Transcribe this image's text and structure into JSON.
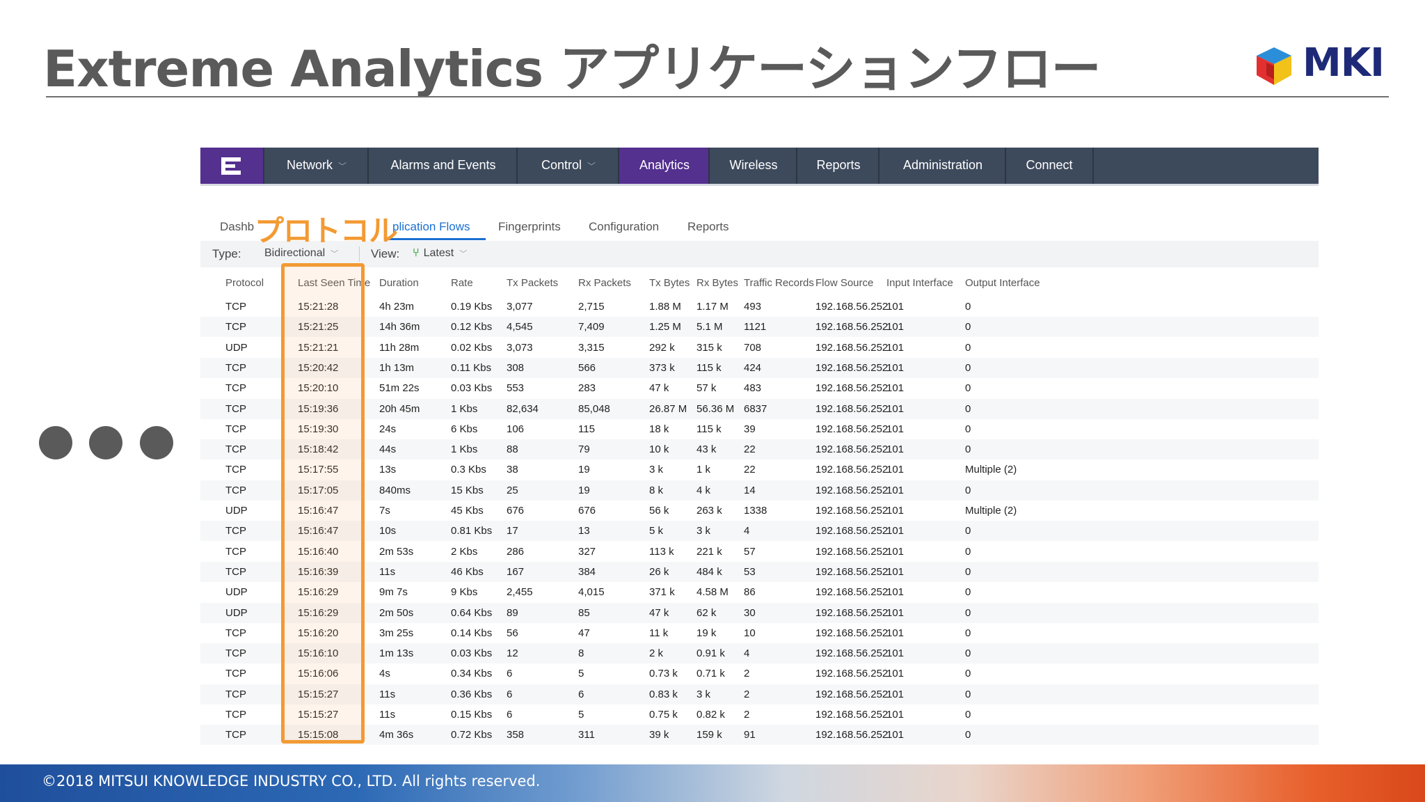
{
  "slide": {
    "title": "Extreme Analytics アプリケーションフロー",
    "logo_text": "MKI",
    "footer": "©2018 MITSUI KNOWLEDGE INDUSTRY CO., LTD. All rights reserved.",
    "annotation": "プロトコル"
  },
  "colors": {
    "nav_bg": "#3d4a5c",
    "nav_active": "#54308f",
    "highlight": "#f39a33",
    "link": "#1a6fd1"
  },
  "nav": {
    "logo_icon": "extreme-e-icon",
    "items": [
      "Network",
      "Alarms and Events",
      "Control",
      "Analytics",
      "Wireless",
      "Reports",
      "Administration",
      "Connect"
    ],
    "active": "Analytics"
  },
  "subtabs": [
    "Dashb",
    "plication Flows",
    "Fingerprints",
    "Configuration",
    "Reports"
  ],
  "filters": {
    "type_label": "Type:",
    "type_value": "Bidirectional",
    "view_label": "View:",
    "view_value": "Latest"
  },
  "table": {
    "columns": [
      "Protocol",
      "Last Seen Time",
      "Duration",
      "Rate",
      "Tx Packets",
      "Rx Packets",
      "Tx Bytes",
      "Rx Bytes",
      "Traffic Records",
      "Flow Source",
      "Input Interface",
      "Output Interface"
    ],
    "rows": [
      [
        "TCP",
        "15:21:28",
        "4h 23m",
        "0.19 Kbs",
        "3,077",
        "2,715",
        "1.88 M",
        "1.17 M",
        "493",
        "192.168.56.252",
        "101",
        "0"
      ],
      [
        "TCP",
        "15:21:25",
        "14h 36m",
        "0.12 Kbs",
        "4,545",
        "7,409",
        "1.25 M",
        "5.1 M",
        "1121",
        "192.168.56.252",
        "101",
        "0"
      ],
      [
        "UDP",
        "15:21:21",
        "11h 28m",
        "0.02 Kbs",
        "3,073",
        "3,315",
        "292 k",
        "315 k",
        "708",
        "192.168.56.252",
        "101",
        "0"
      ],
      [
        "TCP",
        "15:20:42",
        "1h 13m",
        "0.11 Kbs",
        "308",
        "566",
        "373 k",
        "115 k",
        "424",
        "192.168.56.252",
        "101",
        "0"
      ],
      [
        "TCP",
        "15:20:10",
        "51m 22s",
        "0.03 Kbs",
        "553",
        "283",
        "47 k",
        "57 k",
        "483",
        "192.168.56.252",
        "101",
        "0"
      ],
      [
        "TCP",
        "15:19:36",
        "20h 45m",
        "1 Kbs",
        "82,634",
        "85,048",
        "26.87 M",
        "56.36 M",
        "6837",
        "192.168.56.252",
        "101",
        "0"
      ],
      [
        "TCP",
        "15:19:30",
        "24s",
        "6 Kbs",
        "106",
        "115",
        "18 k",
        "115 k",
        "39",
        "192.168.56.252",
        "101",
        "0"
      ],
      [
        "TCP",
        "15:18:42",
        "44s",
        "1 Kbs",
        "88",
        "79",
        "10 k",
        "43 k",
        "22",
        "192.168.56.252",
        "101",
        "0"
      ],
      [
        "TCP",
        "15:17:55",
        "13s",
        "0.3 Kbs",
        "38",
        "19",
        "3 k",
        "1 k",
        "22",
        "192.168.56.252",
        "101",
        "Multiple (2)"
      ],
      [
        "TCP",
        "15:17:05",
        "840ms",
        "15 Kbs",
        "25",
        "19",
        "8 k",
        "4 k",
        "14",
        "192.168.56.252",
        "101",
        "0"
      ],
      [
        "UDP",
        "15:16:47",
        "7s",
        "45 Kbs",
        "676",
        "676",
        "56 k",
        "263 k",
        "1338",
        "192.168.56.252",
        "101",
        "Multiple (2)"
      ],
      [
        "TCP",
        "15:16:47",
        "10s",
        "0.81 Kbs",
        "17",
        "13",
        "5 k",
        "3 k",
        "4",
        "192.168.56.252",
        "101",
        "0"
      ],
      [
        "TCP",
        "15:16:40",
        "2m 53s",
        "2 Kbs",
        "286",
        "327",
        "113 k",
        "221 k",
        "57",
        "192.168.56.252",
        "101",
        "0"
      ],
      [
        "TCP",
        "15:16:39",
        "11s",
        "46 Kbs",
        "167",
        "384",
        "26 k",
        "484 k",
        "53",
        "192.168.56.252",
        "101",
        "0"
      ],
      [
        "UDP",
        "15:16:29",
        "9m 7s",
        "9 Kbs",
        "2,455",
        "4,015",
        "371 k",
        "4.58 M",
        "86",
        "192.168.56.252",
        "101",
        "0"
      ],
      [
        "UDP",
        "15:16:29",
        "2m 50s",
        "0.64 Kbs",
        "89",
        "85",
        "47 k",
        "62 k",
        "30",
        "192.168.56.252",
        "101",
        "0"
      ],
      [
        "TCP",
        "15:16:20",
        "3m 25s",
        "0.14 Kbs",
        "56",
        "47",
        "11 k",
        "19 k",
        "10",
        "192.168.56.252",
        "101",
        "0"
      ],
      [
        "TCP",
        "15:16:10",
        "1m 13s",
        "0.03 Kbs",
        "12",
        "8",
        "2 k",
        "0.91 k",
        "4",
        "192.168.56.252",
        "101",
        "0"
      ],
      [
        "TCP",
        "15:16:06",
        "4s",
        "0.34 Kbs",
        "6",
        "5",
        "0.73 k",
        "0.71 k",
        "2",
        "192.168.56.252",
        "101",
        "0"
      ],
      [
        "TCP",
        "15:15:27",
        "11s",
        "0.36 Kbs",
        "6",
        "6",
        "0.83 k",
        "3 k",
        "2",
        "192.168.56.252",
        "101",
        "0"
      ],
      [
        "TCP",
        "15:15:27",
        "11s",
        "0.15 Kbs",
        "6",
        "5",
        "0.75 k",
        "0.82 k",
        "2",
        "192.168.56.252",
        "101",
        "0"
      ],
      [
        "TCP",
        "15:15:08",
        "4m 36s",
        "0.72 Kbs",
        "358",
        "311",
        "39 k",
        "159 k",
        "91",
        "192.168.56.252",
        "101",
        "0"
      ]
    ]
  }
}
